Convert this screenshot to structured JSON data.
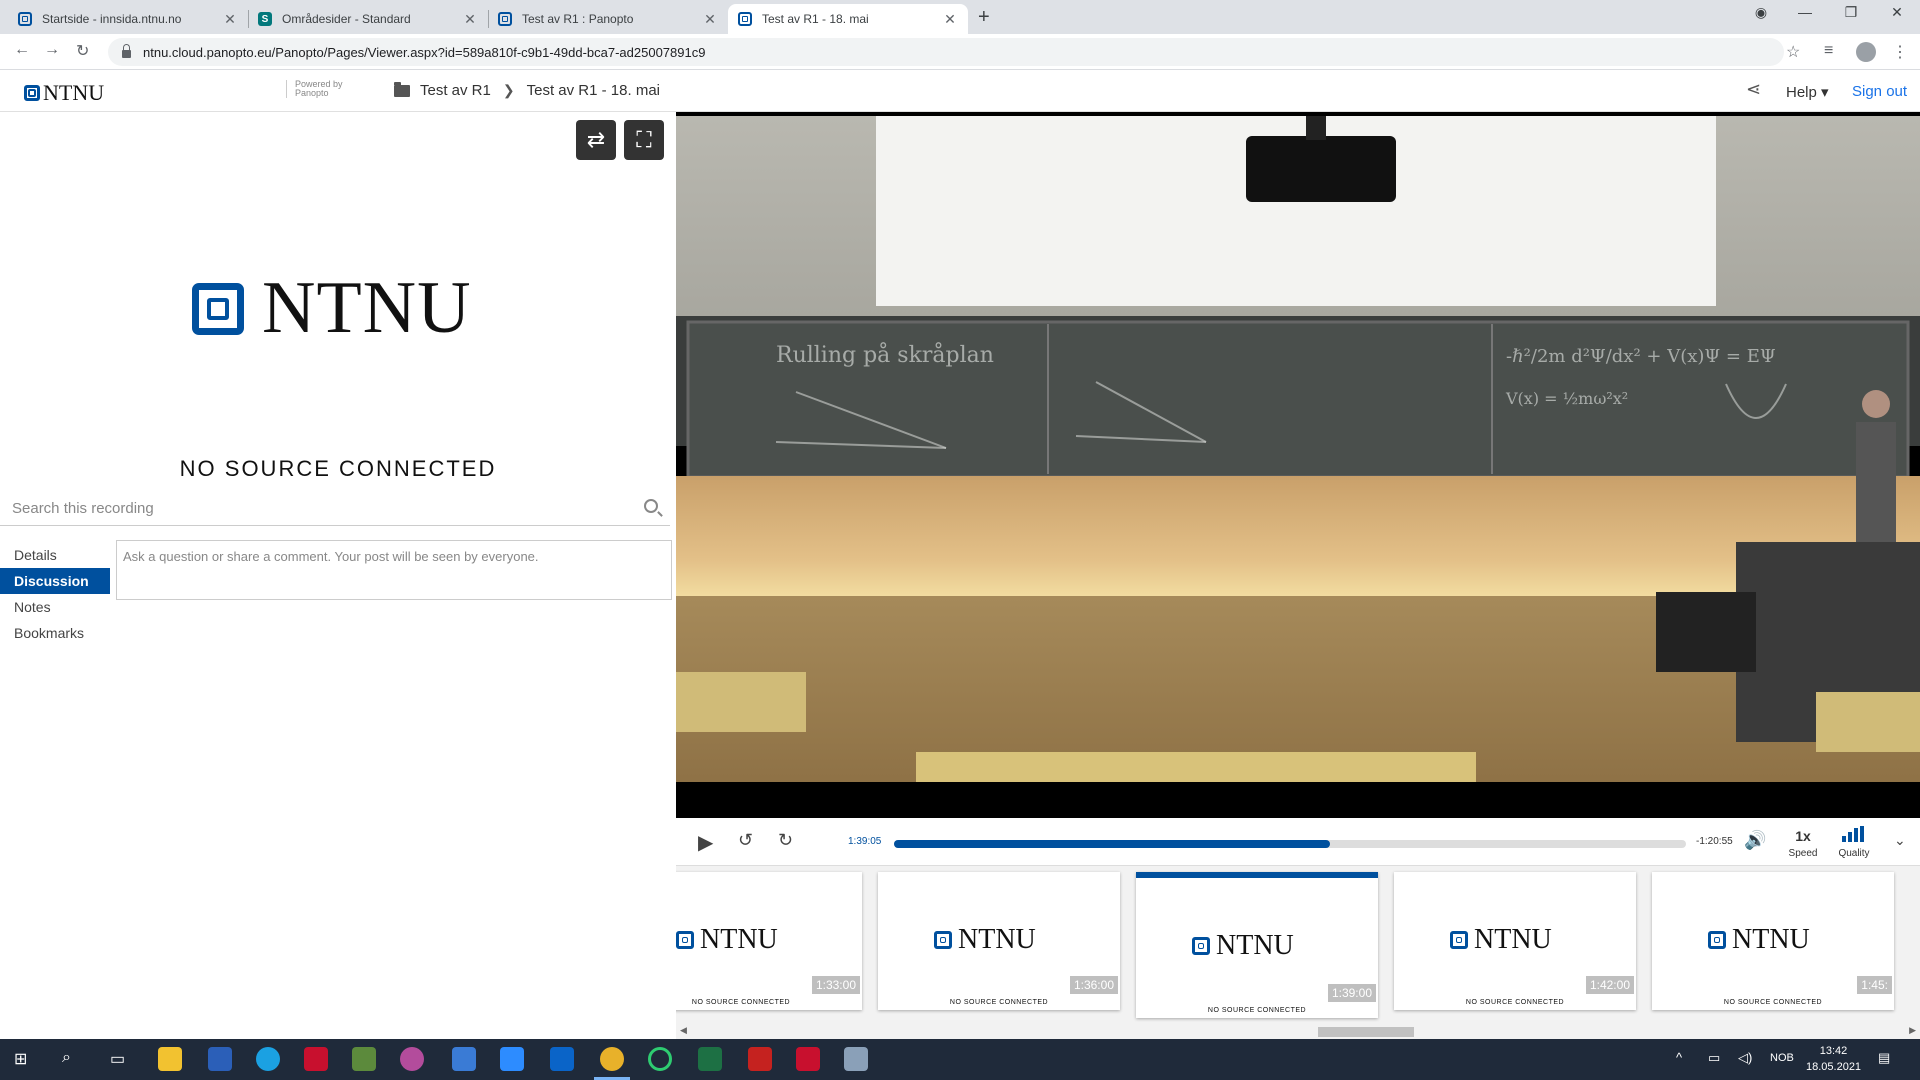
{
  "browser": {
    "tabs": [
      {
        "label": "Startside - innsida.ntnu.no",
        "icon": "ntnu-favicon"
      },
      {
        "label": "Områdesider - Standard",
        "icon": "sharepoint-favicon"
      },
      {
        "label": "Test av R1 : Panopto",
        "icon": "ntnu-favicon"
      },
      {
        "label": "Test av R1 - 18. mai",
        "icon": "ntnu-favicon",
        "active": true
      }
    ],
    "url": "ntnu.cloud.panopto.eu/Panopto/Pages/Viewer.aspx?id=589a810f-c9b1-49dd-bca7-ad25007891c9"
  },
  "header": {
    "logo": "NTNU",
    "powered_by": "Powered by Panopto",
    "breadcrumbs": [
      "Test av R1",
      "Test av R1 - 18. mai"
    ],
    "help": "Help",
    "sign_out": "Sign out"
  },
  "left": {
    "logo_text": "NTNU",
    "no_source": "NO SOURCE CONNECTED",
    "search_placeholder": "Search this recording",
    "tabs": [
      "Details",
      "Discussion",
      "Notes",
      "Bookmarks"
    ],
    "active_tab": "Discussion",
    "comment_placeholder": "Ask a question or share a comment. Your post will be seen by everyone."
  },
  "player": {
    "elapsed": "1:39:05",
    "remaining": "-1:20:55",
    "progress_fraction": 0.55,
    "speed": "1x",
    "speed_label": "Speed",
    "quality_label": "Quality"
  },
  "thumbnails": [
    {
      "time": "1:33:00",
      "logo": "NTNU",
      "caption": "NO SOURCE CONNECTED"
    },
    {
      "time": "1:36:00",
      "logo": "NTNU",
      "caption": "NO SOURCE CONNECTED"
    },
    {
      "time": "1:39:00",
      "logo": "NTNU",
      "caption": "NO SOURCE CONNECTED",
      "active": true
    },
    {
      "time": "1:42:00",
      "logo": "NTNU",
      "caption": "NO SOURCE CONNECTED"
    },
    {
      "time": "1:45:",
      "logo": "NTNU",
      "caption": "NO SOURCE CONNECTED"
    }
  ],
  "taskbar": {
    "language": "NOB",
    "time": "13:42",
    "date": "18.05.2021"
  },
  "colors": {
    "brand": "#00509e",
    "link": "#1a73e8"
  }
}
